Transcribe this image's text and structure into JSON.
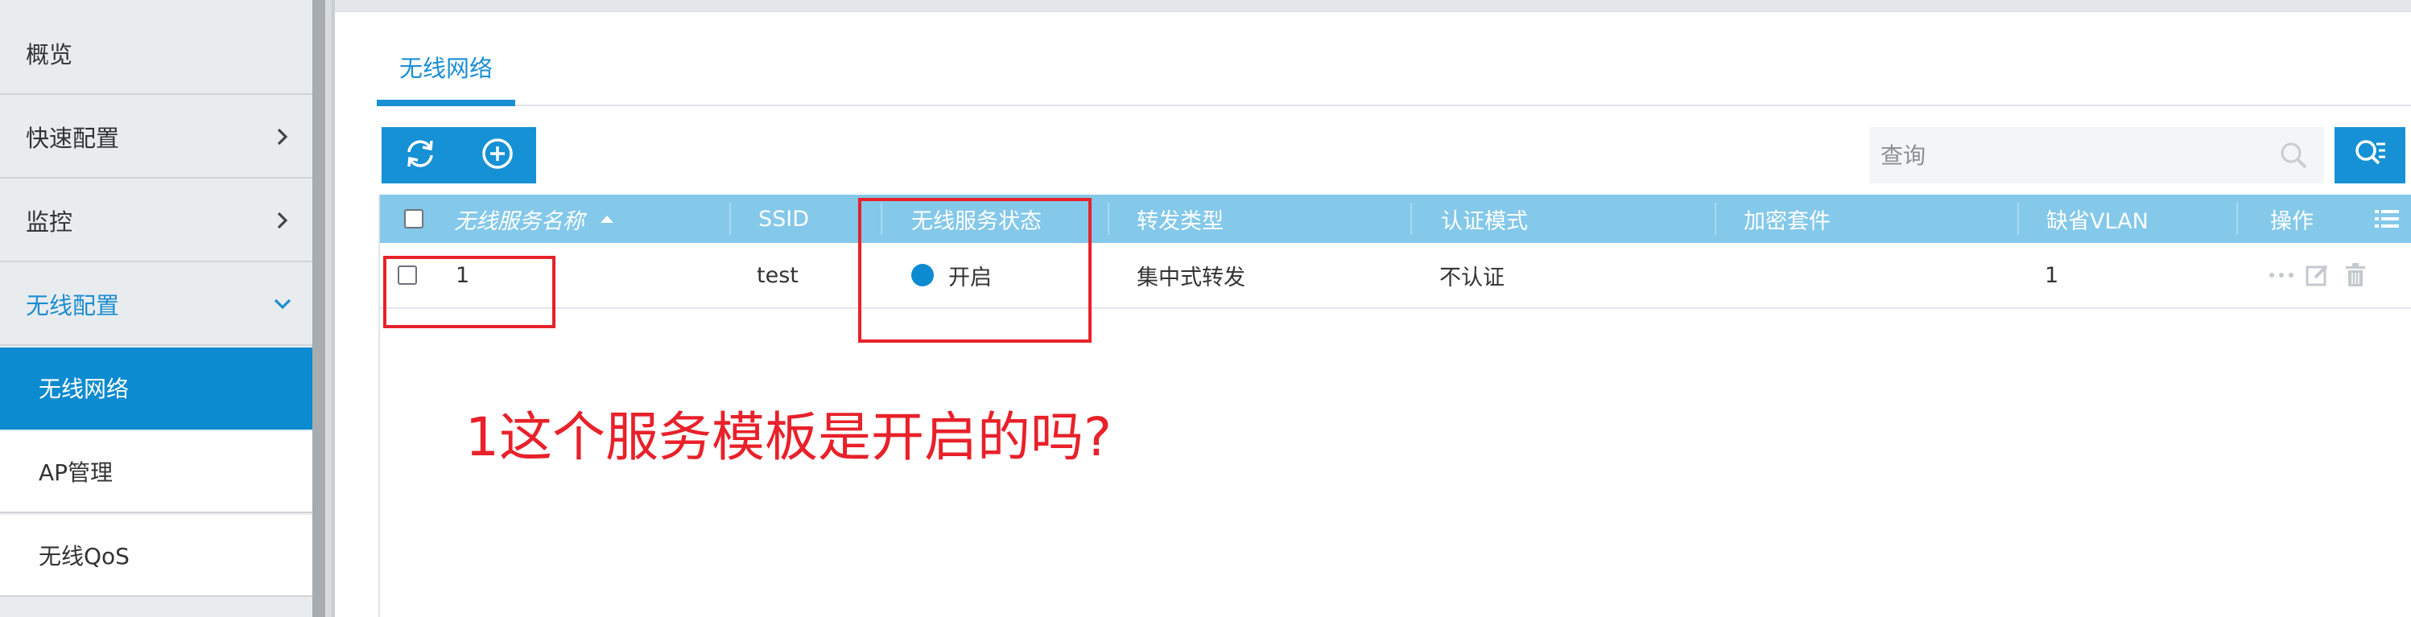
{
  "sidebar": {
    "items": [
      {
        "label": "概览"
      },
      {
        "label": "快速配置"
      },
      {
        "label": "监控"
      },
      {
        "label": "无线配置"
      }
    ],
    "sub_items": [
      {
        "label": "无线网络"
      },
      {
        "label": "AP管理"
      },
      {
        "label": "无线QoS"
      }
    ]
  },
  "tabs": [
    {
      "label": "无线网络"
    }
  ],
  "search": {
    "placeholder": "查询"
  },
  "table": {
    "columns": [
      "无线服务名称",
      "SSID",
      "无线服务状态",
      "转发类型",
      "认证模式",
      "加密套件",
      "缺省VLAN",
      "操作"
    ],
    "rows": [
      {
        "name": "1",
        "ssid": "test",
        "status": "开启",
        "forward": "集中式转发",
        "auth": "不认证",
        "cipher": "",
        "vlan": "1"
      }
    ]
  },
  "annotation": {
    "text": "1这个服务模板是开启的吗?"
  },
  "colors": {
    "accent": "#1691d6",
    "header": "#84c8ea",
    "annotation": "#e8212a",
    "status_on": "#0c8bd0"
  },
  "icons": [
    "chevron-right-icon",
    "chevron-down-icon",
    "refresh-icon",
    "add-icon",
    "search-icon",
    "advanced-search-icon",
    "column-settings-icon",
    "more-icon",
    "edit-icon",
    "delete-icon",
    "sort-asc-icon"
  ]
}
